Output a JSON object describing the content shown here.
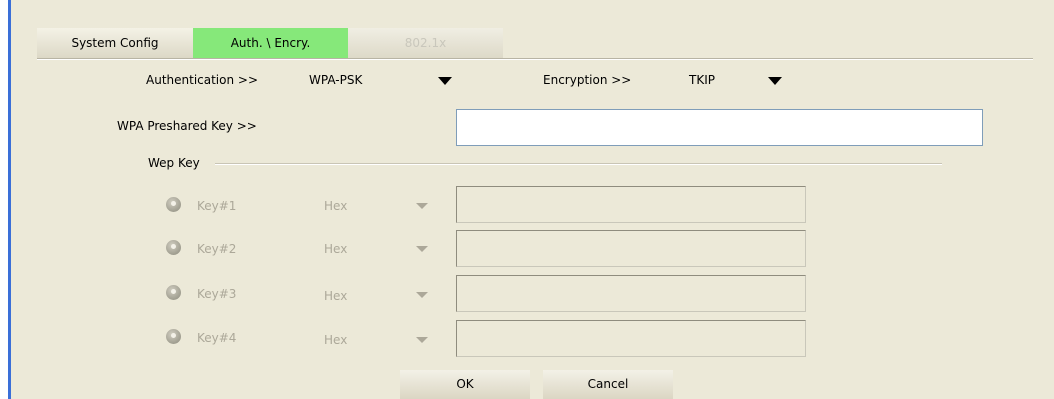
{
  "tabs": [
    {
      "label": "System Config",
      "state": "normal"
    },
    {
      "label": "Auth. \\ Encry.",
      "state": "selected"
    },
    {
      "label": "802.1x",
      "state": "disabled"
    }
  ],
  "auth": {
    "authentication_label": "Authentication >>",
    "authentication_value": "WPA-PSK",
    "encryption_label": "Encryption >>",
    "encryption_value": "TKIP",
    "preshared_label": "WPA Preshared Key >>",
    "preshared_value": ""
  },
  "wep": {
    "group_label": "Wep Key",
    "keys": [
      {
        "label": "Key#1",
        "format": "Hex",
        "value": ""
      },
      {
        "label": "Key#2",
        "format": "Hex",
        "value": ""
      },
      {
        "label": "Key#3",
        "format": "Hex",
        "value": ""
      },
      {
        "label": "Key#4",
        "format": "Hex",
        "value": ""
      }
    ]
  },
  "buttons": {
    "ok": "OK",
    "cancel": "Cancel"
  },
  "colors": {
    "selected_tab": "#86e87a",
    "panel_bg": "#ece9d8",
    "left_accent": "#3a6fd8"
  }
}
